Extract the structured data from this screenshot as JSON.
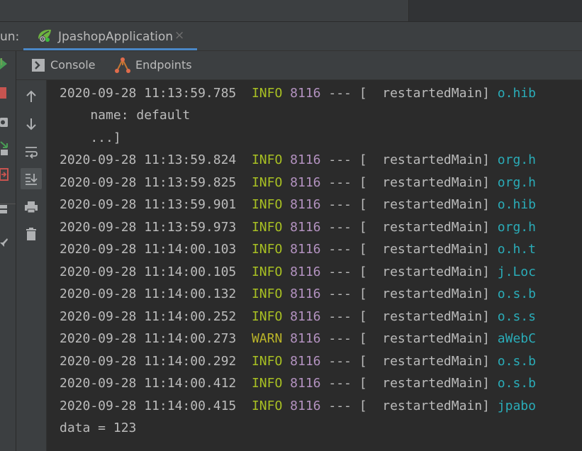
{
  "window": {
    "run_label": "un:",
    "run_tab": {
      "title": "JpashopApplication",
      "close": "×"
    }
  },
  "subtabs": [
    {
      "label": "Console",
      "icon": "console-icon"
    },
    {
      "label": "Endpoints",
      "icon": "endpoints-icon"
    }
  ],
  "left_strip_icons": [
    "rerun-icon",
    "stop-icon",
    "camera-icon",
    "restore-layout-icon",
    "exit-icon",
    "layout-icon",
    "pin-icon"
  ],
  "tools": [
    "up-arrow-icon",
    "down-arrow-icon",
    "soft-wrap-icon",
    "scroll-to-end-icon",
    "print-icon",
    "trash-icon"
  ],
  "console": {
    "first": {
      "date": "2020-09-28",
      "time": "11:13:59.785",
      "level": "INFO",
      "pid": "8116",
      "sep": "---",
      "thread": "[  restartedMain]",
      "logger": "o.hib"
    },
    "continuation": [
      "    name: default",
      "    ...]"
    ],
    "entries": [
      {
        "date": "2020-09-28",
        "time": "11:13:59.824",
        "level": "INFO",
        "pid": "8116",
        "sep": "---",
        "thread": "[  restartedMain]",
        "logger": "org.h"
      },
      {
        "date": "2020-09-28",
        "time": "11:13:59.825",
        "level": "INFO",
        "pid": "8116",
        "sep": "---",
        "thread": "[  restartedMain]",
        "logger": "org.h"
      },
      {
        "date": "2020-09-28",
        "time": "11:13:59.901",
        "level": "INFO",
        "pid": "8116",
        "sep": "---",
        "thread": "[  restartedMain]",
        "logger": "o.hib"
      },
      {
        "date": "2020-09-28",
        "time": "11:13:59.973",
        "level": "INFO",
        "pid": "8116",
        "sep": "---",
        "thread": "[  restartedMain]",
        "logger": "org.h"
      },
      {
        "date": "2020-09-28",
        "time": "11:14:00.103",
        "level": "INFO",
        "pid": "8116",
        "sep": "---",
        "thread": "[  restartedMain]",
        "logger": "o.h.t"
      },
      {
        "date": "2020-09-28",
        "time": "11:14:00.105",
        "level": "INFO",
        "pid": "8116",
        "sep": "---",
        "thread": "[  restartedMain]",
        "logger": "j.Loc"
      },
      {
        "date": "2020-09-28",
        "time": "11:14:00.132",
        "level": "INFO",
        "pid": "8116",
        "sep": "---",
        "thread": "[  restartedMain]",
        "logger": "o.s.b"
      },
      {
        "date": "2020-09-28",
        "time": "11:14:00.252",
        "level": "INFO",
        "pid": "8116",
        "sep": "---",
        "thread": "[  restartedMain]",
        "logger": "o.s.s"
      },
      {
        "date": "2020-09-28",
        "time": "11:14:00.273",
        "level": "WARN",
        "pid": "8116",
        "sep": "---",
        "thread": "[  restartedMain]",
        "logger": "aWebC"
      },
      {
        "date": "2020-09-28",
        "time": "11:14:00.292",
        "level": "INFO",
        "pid": "8116",
        "sep": "---",
        "thread": "[  restartedMain]",
        "logger": "o.s.b"
      },
      {
        "date": "2020-09-28",
        "time": "11:14:00.412",
        "level": "INFO",
        "pid": "8116",
        "sep": "---",
        "thread": "[  restartedMain]",
        "logger": "o.s.b"
      },
      {
        "date": "2020-09-28",
        "time": "11:14:00.415",
        "level": "INFO",
        "pid": "8116",
        "sep": "---",
        "thread": "[  restartedMain]",
        "logger": "jpabo"
      }
    ],
    "output": "data = 123"
  },
  "colors": {
    "info": "#a8c023",
    "warn": "#bbb529",
    "pid": "#b392c0",
    "logger": "#2aacb8",
    "accent": "#4a88c7"
  }
}
